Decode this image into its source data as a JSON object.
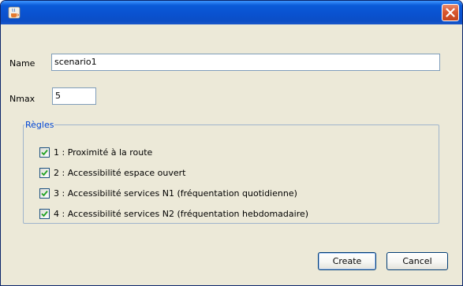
{
  "window": {
    "title": "",
    "icons": {
      "app": "java-cup-icon",
      "close": "close-icon"
    }
  },
  "form": {
    "name_label": "Name",
    "name_value": "scenario1",
    "nmax_label": "Nmax",
    "nmax_value": "5"
  },
  "rules": {
    "legend": "Règles",
    "items": [
      {
        "label": "1 : Proximité à la route",
        "checked": true
      },
      {
        "label": "2 : Accessibilité espace ouvert",
        "checked": true
      },
      {
        "label": "3 : Accessibilité services N1 (fréquentation quotidienne)",
        "checked": true
      },
      {
        "label": "4 : Accessibilité services N2 (fréquentation hebdomadaire)",
        "checked": true
      }
    ]
  },
  "buttons": {
    "create": "Create",
    "cancel": "Cancel"
  },
  "colors": {
    "titlebar": "#0a52d0",
    "dialog_bg": "#ece9d8",
    "legend_text": "#0046d5",
    "checkmark": "#21a121",
    "close_button": "#d9582f"
  }
}
